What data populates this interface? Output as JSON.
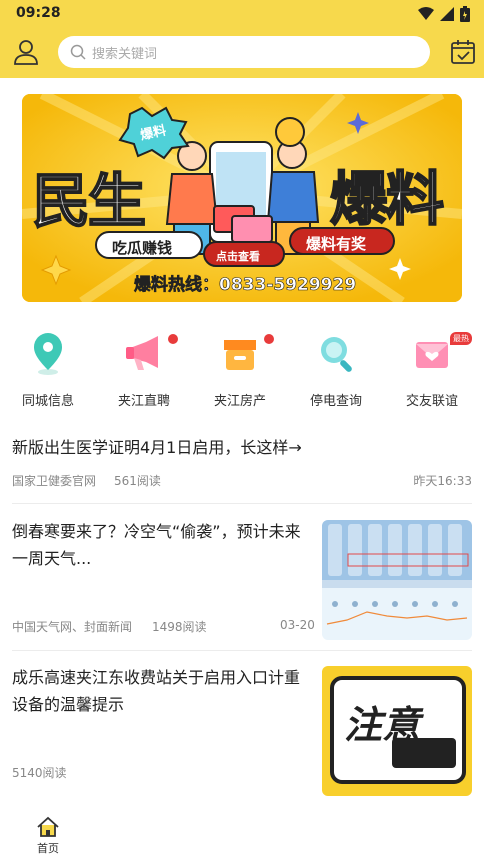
{
  "status_bar": {
    "time": "09:28"
  },
  "search": {
    "placeholder": "搜索关键词"
  },
  "banner": {
    "tag": "爆料",
    "big_left": "民生",
    "big_right": "爆料",
    "pill_left": "吃瓜赚钱",
    "pill_mid": "点击查看",
    "pill_right": "爆料有奖",
    "hotline": "爆料热线：0833-5929929"
  },
  "quick_links": [
    {
      "label": "同城信息",
      "icon": "location-pin-icon",
      "dot": false
    },
    {
      "label": "夹江直聘",
      "icon": "megaphone-icon",
      "dot": true
    },
    {
      "label": "夹江房产",
      "icon": "shop-icon",
      "dot": true
    },
    {
      "label": "停电查询",
      "icon": "magnifier-icon",
      "dot": false
    },
    {
      "label": "交友联谊",
      "icon": "love-letter-icon",
      "dot": false,
      "badge": "最热"
    }
  ],
  "news": [
    {
      "title": "新版出生医学证明4月1日启用，长这样→",
      "source": "国家卫健委官网",
      "reads": "561阅读",
      "time": "昨天16:33"
    },
    {
      "title": "倒春寒要来了？冷空气“偷袭”，预计未来一周天气...",
      "source": "中国天气网、封面新闻",
      "reads": "1498阅读",
      "time": "03-20"
    },
    {
      "title": "成乐高速夹江东收费站关于启用入口计重设备的温馨提示",
      "source": "",
      "reads": "5140阅读",
      "time": "",
      "thumb_text": "注意"
    }
  ],
  "tabbar": {
    "home_label": "首页"
  },
  "colors": {
    "brand_yellow": "#f7d94c",
    "badge_red": "#e83b3b"
  }
}
